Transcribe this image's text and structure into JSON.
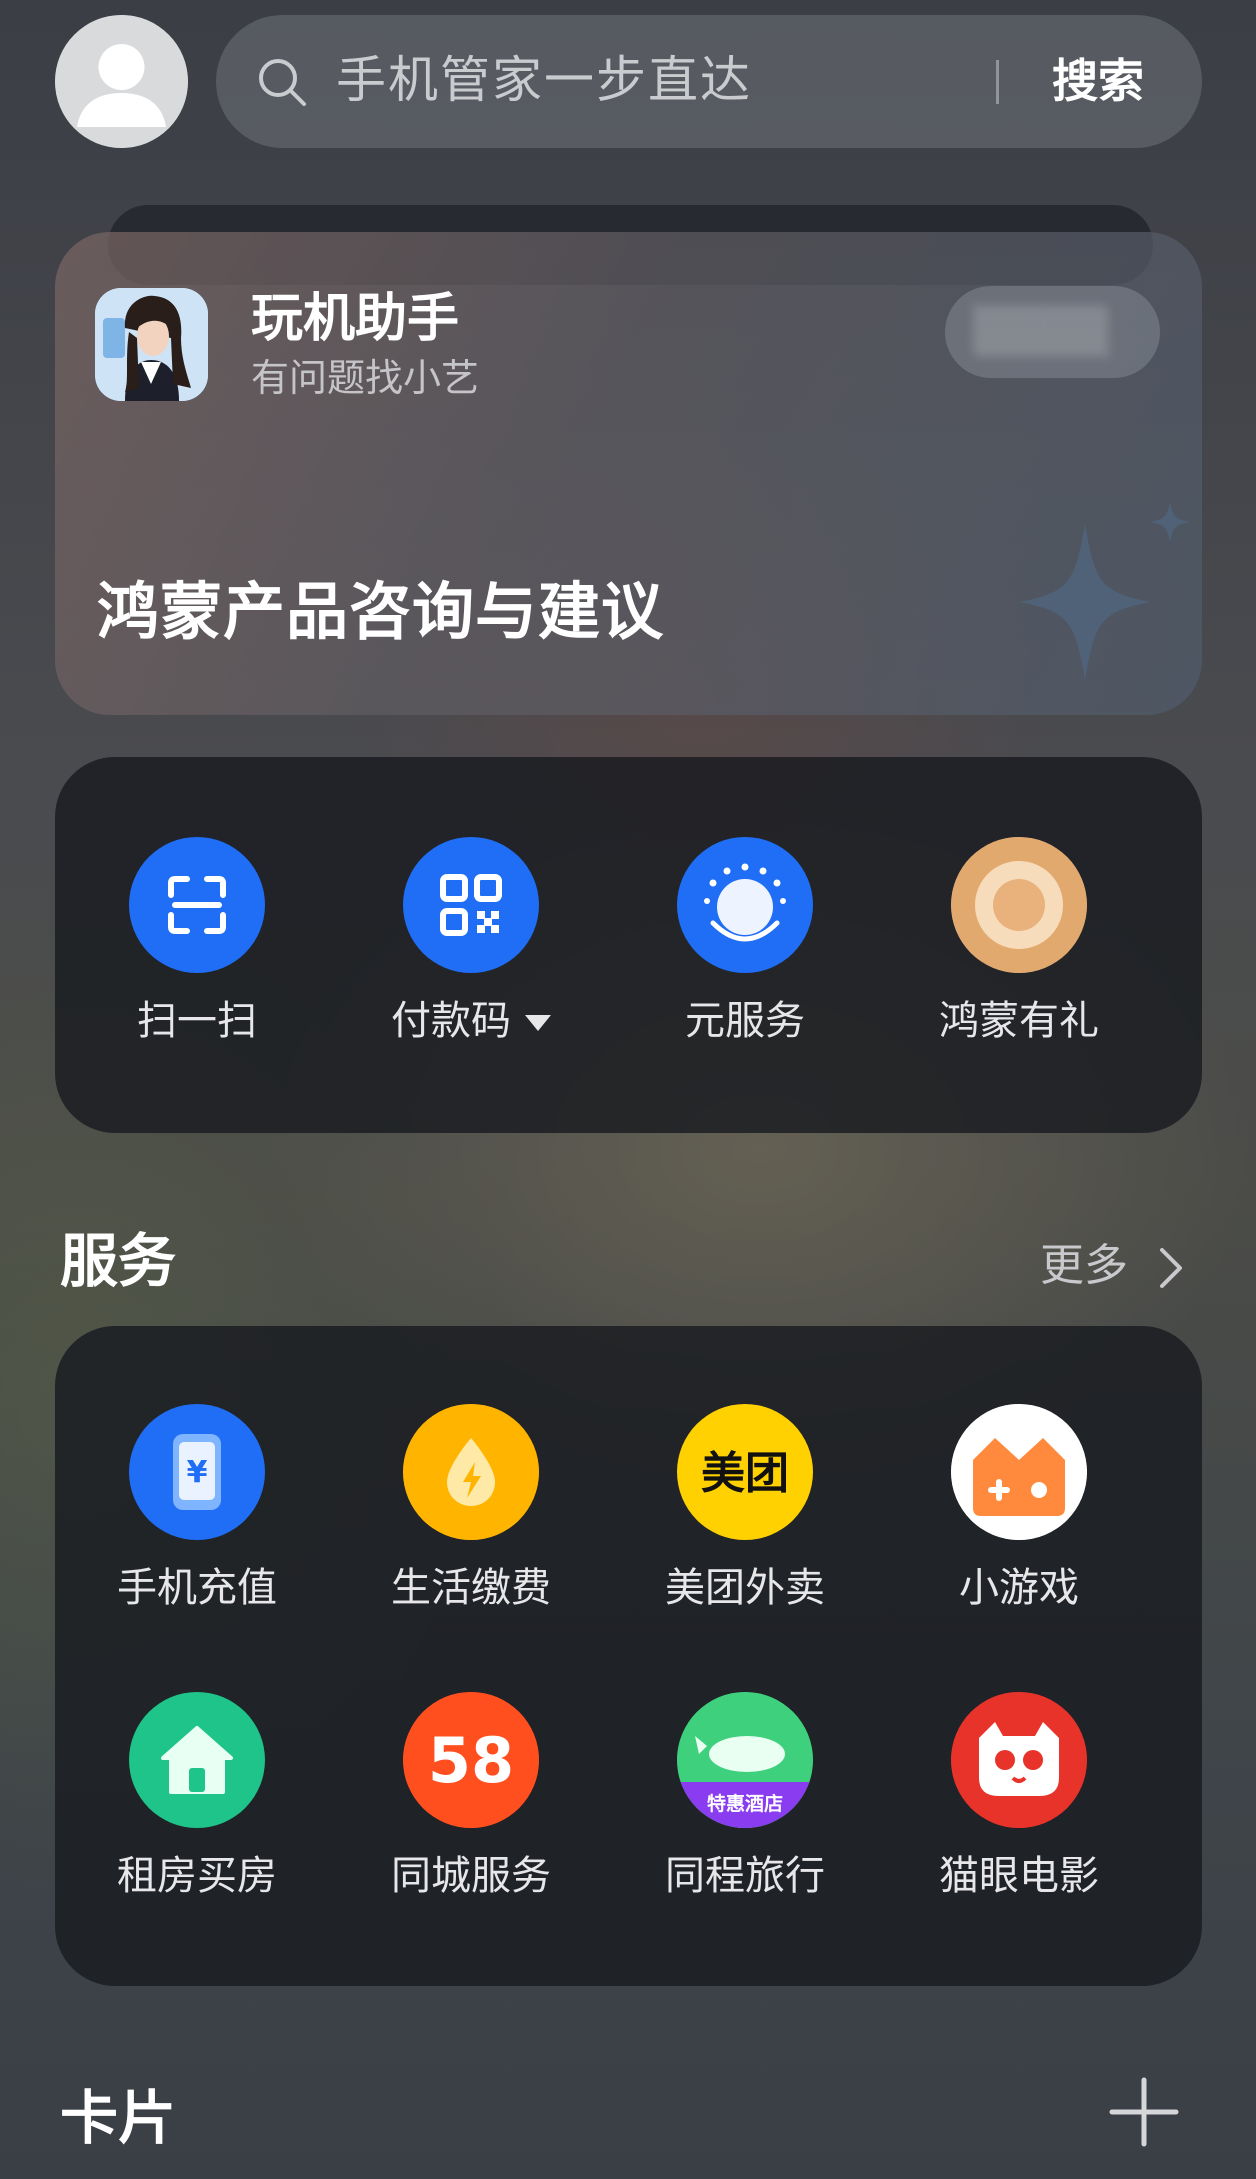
{
  "search": {
    "placeholder": "手机管家一步直达",
    "button": "搜索"
  },
  "assistant": {
    "title": "玩机助手",
    "subtitle": "有问题找小艺",
    "headline": "鸿蒙产品咨询与建议"
  },
  "quick_actions": [
    {
      "label": "扫一扫",
      "icon": "scan-icon"
    },
    {
      "label": "付款码",
      "icon": "qr-code-icon"
    },
    {
      "label": "元服务",
      "icon": "atomic-service-icon"
    },
    {
      "label": "鸿蒙有礼",
      "icon": "gift-ring-icon"
    }
  ],
  "services": {
    "title": "服务",
    "more": "更多",
    "items": [
      {
        "label": "手机充值",
        "icon": "phone-recharge-icon"
      },
      {
        "label": "生活缴费",
        "icon": "utility-bill-icon"
      },
      {
        "label": "美团外卖",
        "icon": "meituan-icon",
        "icon_text": "美团"
      },
      {
        "label": "小游戏",
        "icon": "mini-game-icon"
      },
      {
        "label": "租房买房",
        "icon": "house-icon"
      },
      {
        "label": "同城服务",
        "icon": "58-icon",
        "icon_text": "58"
      },
      {
        "label": "同程旅行",
        "icon": "tongcheng-icon",
        "icon_text": "特惠酒店"
      },
      {
        "label": "猫眼电影",
        "icon": "maoyan-icon"
      }
    ]
  },
  "cards": {
    "title": "卡片"
  },
  "colors": {
    "blue": "#1f6ef5",
    "yellow": "#ffc300",
    "green": "#1fc48a",
    "red": "#f0392b",
    "gold": "#e6b07a"
  }
}
